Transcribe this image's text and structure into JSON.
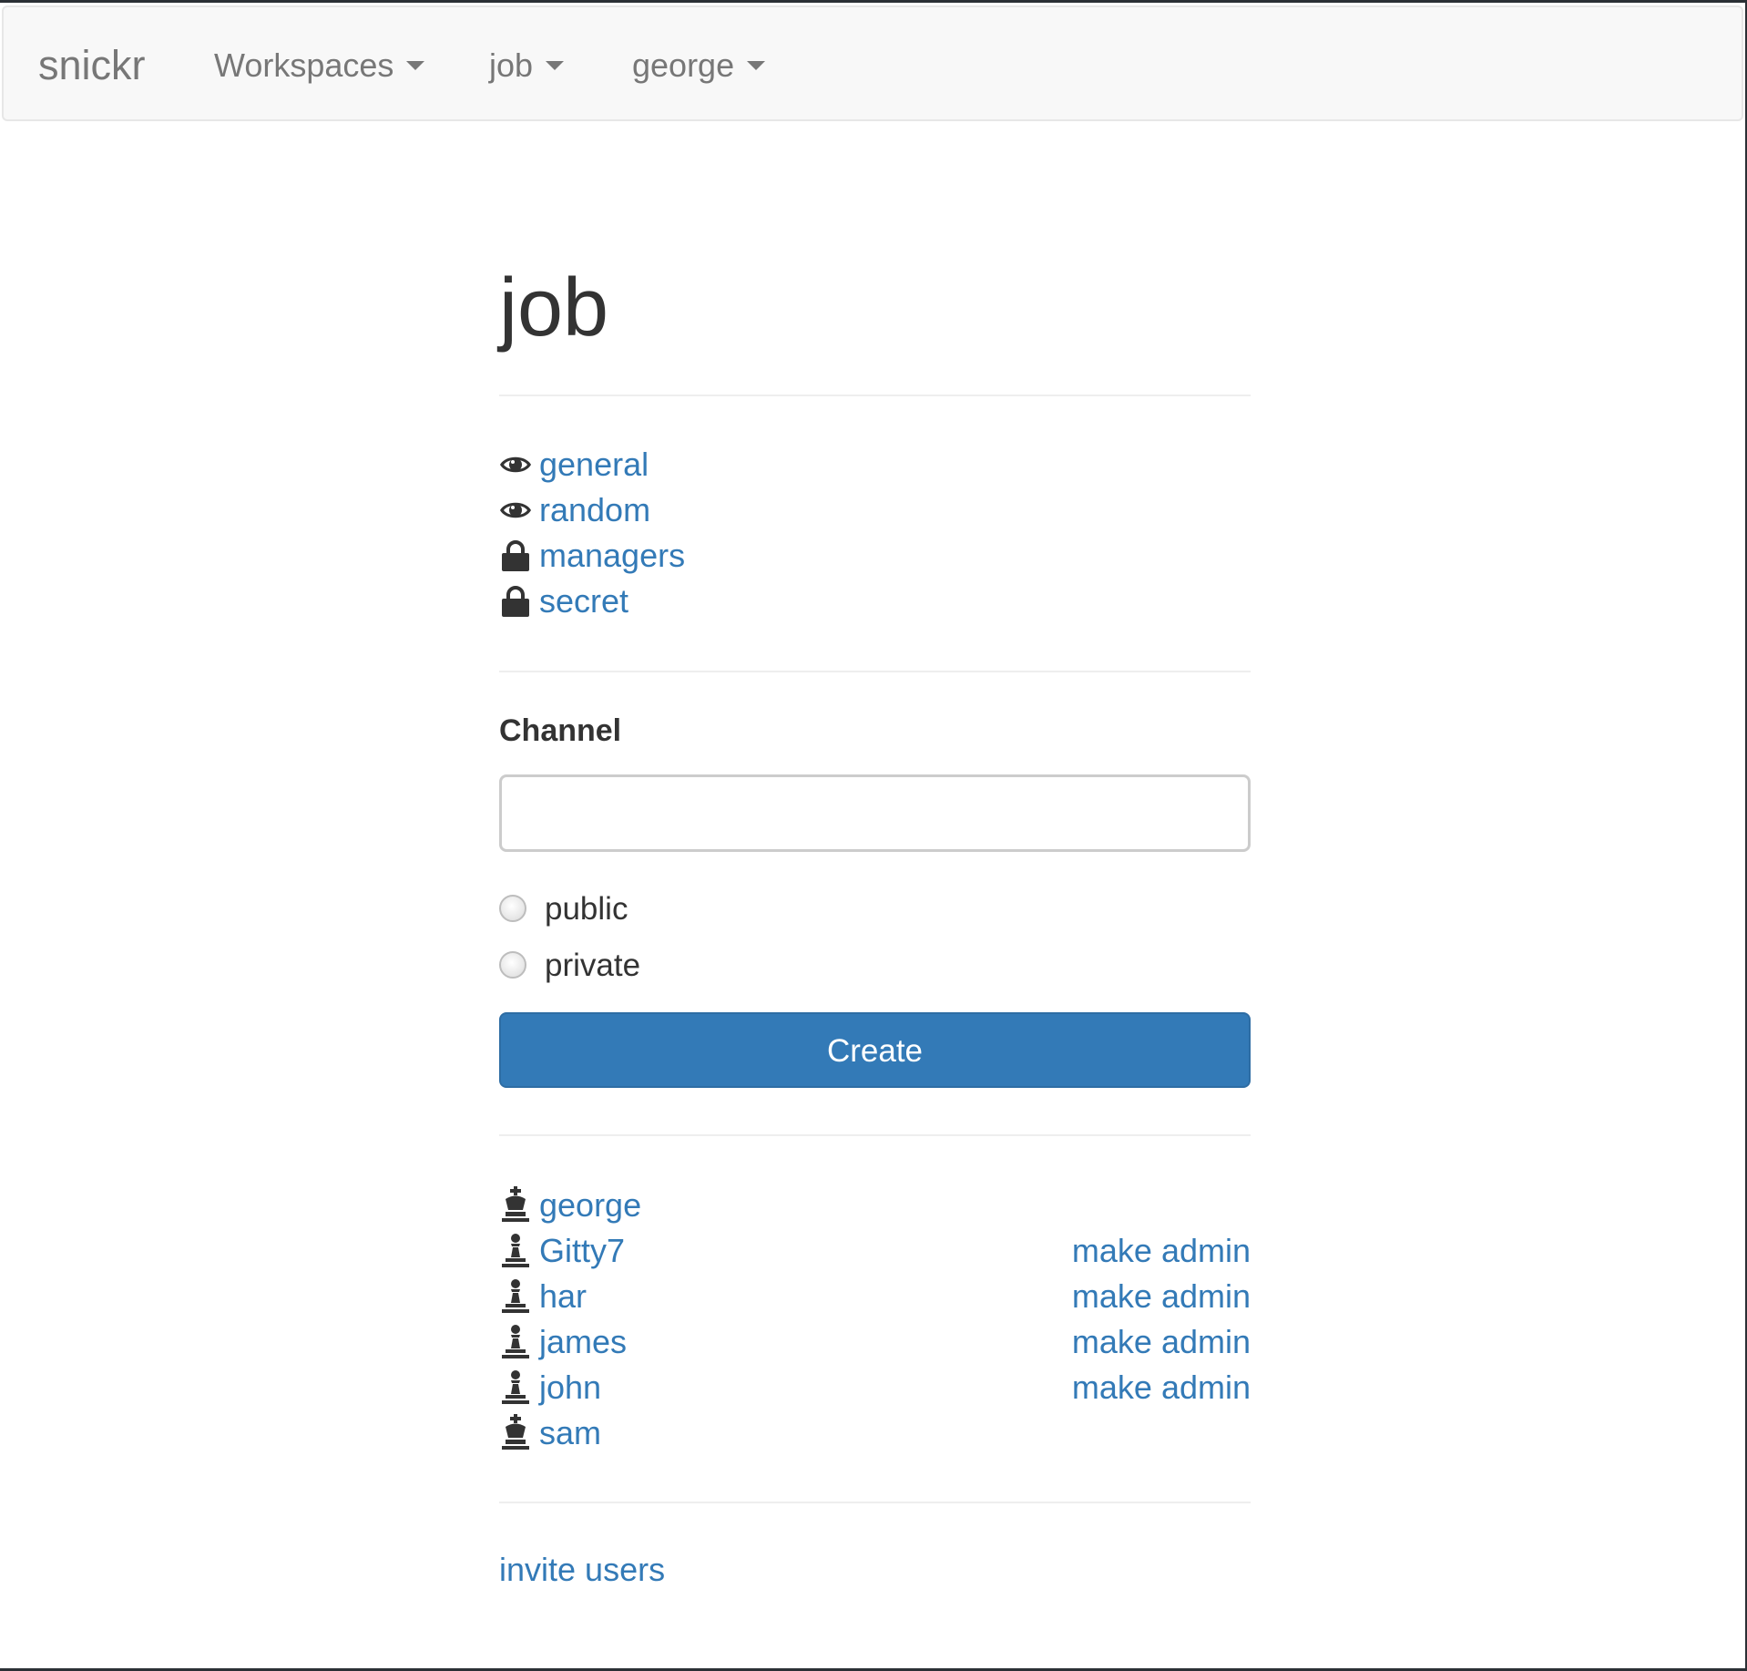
{
  "navbar": {
    "brand": "snickr",
    "items": [
      {
        "label": "Workspaces"
      },
      {
        "label": "job"
      },
      {
        "label": "george"
      }
    ]
  },
  "workspace": {
    "title": "job"
  },
  "channels": [
    {
      "name": "general",
      "icon": "eye-icon"
    },
    {
      "name": "random",
      "icon": "eye-icon"
    },
    {
      "name": "managers",
      "icon": "lock-icon"
    },
    {
      "name": "secret",
      "icon": "lock-icon"
    }
  ],
  "create_form": {
    "label": "Channel",
    "input_value": "",
    "radios": [
      {
        "label": "public"
      },
      {
        "label": "private"
      }
    ],
    "submit_label": "Create"
  },
  "members": [
    {
      "name": "george",
      "role_icon": "king-icon",
      "action": ""
    },
    {
      "name": "Gitty7",
      "role_icon": "pawn-icon",
      "action": "make admin"
    },
    {
      "name": "har",
      "role_icon": "pawn-icon",
      "action": "make admin"
    },
    {
      "name": "james",
      "role_icon": "pawn-icon",
      "action": "make admin"
    },
    {
      "name": "john",
      "role_icon": "pawn-icon",
      "action": "make admin"
    },
    {
      "name": "sam",
      "role_icon": "king-icon",
      "action": ""
    }
  ],
  "invite_label": "invite users",
  "colors": {
    "link": "#337ab7",
    "primary_button": "#337ab7",
    "navbar_bg": "#f8f8f8",
    "navbar_text": "#777777"
  }
}
